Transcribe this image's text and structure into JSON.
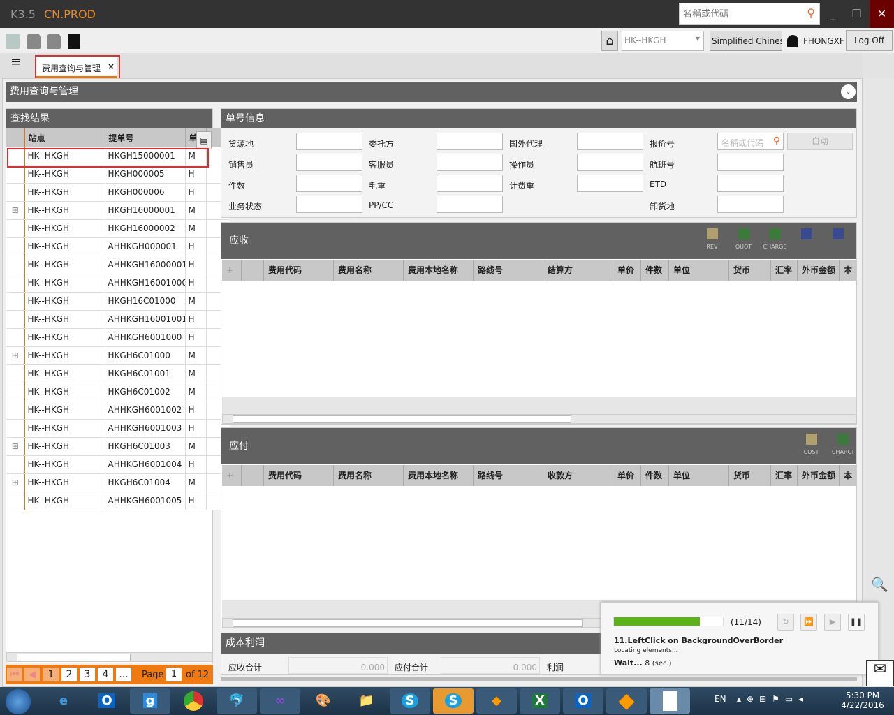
{
  "app": {
    "version": "K3.5",
    "env": "CN.PROD",
    "search_placeholder": "名稱或代碼"
  },
  "toolbar": {
    "station": "HK--HKGH",
    "language": "Simplified Chinese",
    "user": "FHONGXF",
    "logoff": "Log Off"
  },
  "tab": {
    "label": "费用查询与管理",
    "close": "×"
  },
  "page": {
    "title": "费用查询与管理"
  },
  "results": {
    "title": "查找结果",
    "columns": [
      "站点",
      "提单号",
      "单"
    ],
    "rows": [
      {
        "station": "HK--HKGH",
        "bill": "HKGH15000001",
        "type": "M",
        "expand": false
      },
      {
        "station": "HK--HKGH",
        "bill": "HKGH000005",
        "type": "H",
        "expand": false
      },
      {
        "station": "HK--HKGH",
        "bill": "HKGH000006",
        "type": "H",
        "expand": false
      },
      {
        "station": "HK--HKGH",
        "bill": "HKGH16000001",
        "type": "M",
        "expand": true
      },
      {
        "station": "HK--HKGH",
        "bill": "HKGH16000002",
        "type": "M",
        "expand": false
      },
      {
        "station": "HK--HKGH",
        "bill": "AHHKGH000001",
        "type": "H",
        "expand": false
      },
      {
        "station": "HK--HKGH",
        "bill": "AHHKGH16000001",
        "type": "H",
        "expand": false
      },
      {
        "station": "HK--HKGH",
        "bill": "AHHKGH16001000",
        "type": "H",
        "expand": false
      },
      {
        "station": "HK--HKGH",
        "bill": "HKGH16C01000",
        "type": "M",
        "expand": false
      },
      {
        "station": "HK--HKGH",
        "bill": "AHHKGH16001001",
        "type": "H",
        "expand": false
      },
      {
        "station": "HK--HKGH",
        "bill": "AHHKGH6001000",
        "type": "H",
        "expand": false
      },
      {
        "station": "HK--HKGH",
        "bill": "HKGH6C01000",
        "type": "M",
        "expand": true
      },
      {
        "station": "HK--HKGH",
        "bill": "HKGH6C01001",
        "type": "M",
        "expand": false
      },
      {
        "station": "HK--HKGH",
        "bill": "HKGH6C01002",
        "type": "M",
        "expand": false
      },
      {
        "station": "HK--HKGH",
        "bill": "AHHKGH6001002",
        "type": "H",
        "expand": false
      },
      {
        "station": "HK--HKGH",
        "bill": "AHHKGH6001003",
        "type": "H",
        "expand": false
      },
      {
        "station": "HK--HKGH",
        "bill": "HKGH6C01003",
        "type": "M",
        "expand": true
      },
      {
        "station": "HK--HKGH",
        "bill": "AHHKGH6001004",
        "type": "H",
        "expand": false
      },
      {
        "station": "HK--HKGH",
        "bill": "HKGH6C01004",
        "type": "M",
        "expand": true
      },
      {
        "station": "HK--HKGH",
        "bill": "AHHKGH6001005",
        "type": "H",
        "expand": false
      }
    ]
  },
  "pager": {
    "pages": [
      "1",
      "2",
      "3",
      "4",
      "..."
    ],
    "page_label": "Page",
    "current": "1",
    "of": "of 12"
  },
  "info": {
    "title": "单号信息",
    "fields": [
      [
        "货源地",
        "委托方",
        "国外代理",
        "报价号"
      ],
      [
        "销售员",
        "客服员",
        "操作员",
        "航班号"
      ],
      [
        "件数",
        "毛重",
        "计费重",
        "ETD"
      ],
      [
        "业务状态",
        "PP/CC",
        "",
        "卸货地"
      ]
    ],
    "quote_placeholder": "名稱或代碼",
    "auto": "自动"
  },
  "receivable": {
    "title": "应收",
    "buttons": [
      "REV",
      "QUOT",
      "CHARGE",
      "",
      ""
    ],
    "columns": [
      "+",
      "",
      "费用代码",
      "费用名称",
      "费用本地名称",
      "路线号",
      "结算方",
      "单价",
      "件数",
      "单位",
      "货币",
      "汇率",
      "外币金额",
      "本"
    ]
  },
  "payable": {
    "title": "应付",
    "buttons": [
      "COST",
      "CHARGI"
    ],
    "columns": [
      "+",
      "",
      "费用代码",
      "费用名称",
      "费用本地名称",
      "路线号",
      "收款方",
      "单价",
      "件数",
      "单位",
      "货币",
      "汇率",
      "外币金额",
      "本"
    ]
  },
  "profit": {
    "title": "成本利润",
    "rec_label": "应收合计",
    "rec_value": "0.000",
    "pay_label": "应付合计",
    "pay_value": "0.000",
    "profit_label": "利润"
  },
  "popup": {
    "progress": 0.79,
    "count": "(11/14)",
    "step": "11.LeftClick on BackgroundOverBorder",
    "status": "Locating elements...",
    "wait": "Wait...",
    "secs": "8",
    "unit": "(sec.)"
  },
  "taskbar": {
    "lang": "EN",
    "time": "5:30 PM",
    "date": "4/22/2016"
  },
  "colors": {
    "accent": "#ef7a12",
    "header": "#616161",
    "titlebar": "#333333",
    "progress": "#5bb318"
  }
}
